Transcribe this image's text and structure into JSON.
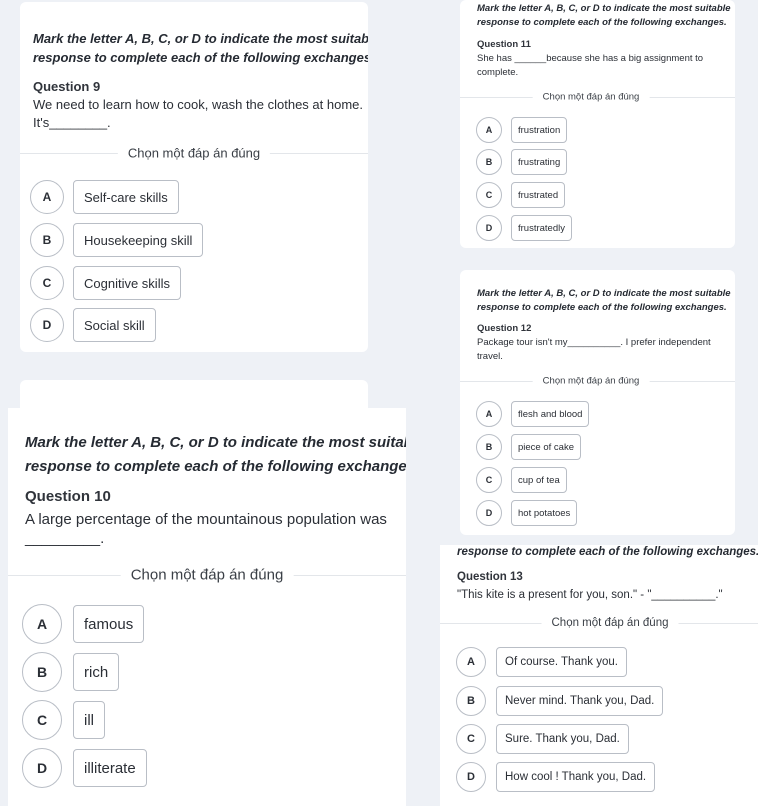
{
  "divider_label": "Chọn một đáp án đúng",
  "instruction_line1": "Mark the letter A, B, C, or D to indicate the most suitable",
  "instruction_line2": "response to complete each of the following exchanges.",
  "letters": [
    "A",
    "B",
    "C",
    "D"
  ],
  "questions": {
    "q9": {
      "title": "Question 9",
      "text_line1": "We need to learn how to cook, wash the clothes at home.",
      "text_line2": "It's________.",
      "options": [
        "Self-care skills",
        "Housekeeping skill",
        "Cognitive skills",
        "Social skill"
      ]
    },
    "q10": {
      "title": "Question 10",
      "text_line1": "A large percentage of the mountainous population was",
      "text_line2": "_________.",
      "options": [
        "famous",
        "rich",
        "ill",
        "illiterate"
      ]
    },
    "q11": {
      "title": "Question 11",
      "text_line1": "She has ______because she has a big assignment to",
      "text_line2": "complete.",
      "options": [
        "frustration",
        "frustrating",
        "frustrated",
        "frustratedly"
      ]
    },
    "q12": {
      "title": "Question 12",
      "text_line1": "Package tour isn't my__________. I prefer independent",
      "text_line2": "travel.",
      "options": [
        "flesh and blood",
        "piece of cake",
        "cup of tea",
        "hot potatoes"
      ]
    },
    "q13": {
      "title": "Question 13",
      "text_line1": "\"This kite is a present for you, son.\"  - \"__________.\"",
      "options": [
        "Of course. Thank you.",
        "Never mind. Thank you, Dad.",
        "Sure. Thank you, Dad.",
        "How cool ! Thank you, Dad."
      ]
    }
  }
}
